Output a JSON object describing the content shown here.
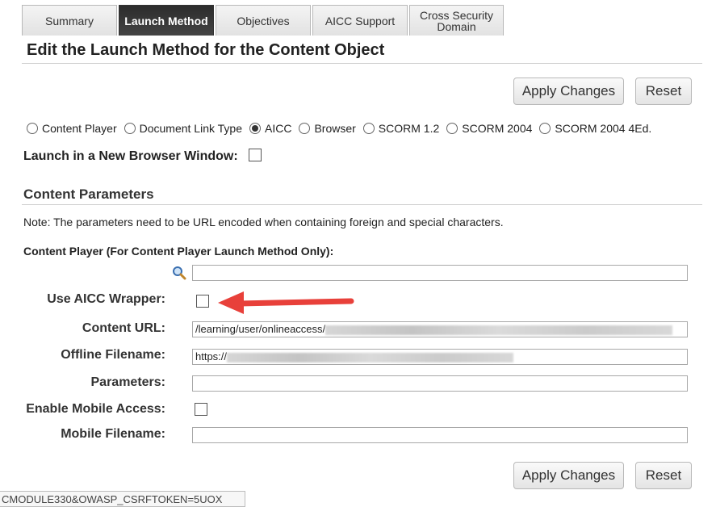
{
  "tabs": [
    {
      "label": "Summary"
    },
    {
      "label": "Launch Method"
    },
    {
      "label": "Objectives"
    },
    {
      "label": "AICC Support"
    },
    {
      "label": "Cross Security Domain"
    }
  ],
  "page_title": "Edit the Launch Method for the Content Object",
  "buttons": {
    "apply": "Apply Changes",
    "reset": "Reset"
  },
  "launch_methods": [
    {
      "label": "Content Player",
      "selected": false
    },
    {
      "label": "Document Link Type",
      "selected": false
    },
    {
      "label": "AICC",
      "selected": true
    },
    {
      "label": "Browser",
      "selected": false
    },
    {
      "label": "SCORM 1.2",
      "selected": false
    },
    {
      "label": "SCORM 2004",
      "selected": false
    },
    {
      "label": "SCORM 2004 4Ed.",
      "selected": false
    }
  ],
  "new_window_label": "Launch in a New Browser Window:",
  "content_params": {
    "title": "Content Parameters",
    "note": "Note: The parameters need to be URL encoded when containing foreign and special characters.",
    "content_player_label": "Content Player (For Content Player Launch Method Only):",
    "use_aicc_wrapper_label": "Use AICC Wrapper:",
    "content_url_label": "Content URL:",
    "content_url_value": "/learning/user/onlineaccess/",
    "offline_filename_label": "Offline Filename:",
    "offline_filename_value": "https://",
    "parameters_label": "Parameters:",
    "enable_mobile_label": "Enable Mobile Access:",
    "mobile_filename_label": "Mobile Filename:"
  },
  "status_url": "CMODULE330&OWASP_CSRFTOKEN=5UOX",
  "icons": {
    "search": "search-icon",
    "arrow": "red-arrow-annotation"
  },
  "colors": {
    "arrow": "#e8403a",
    "active_tab": "#333333"
  }
}
